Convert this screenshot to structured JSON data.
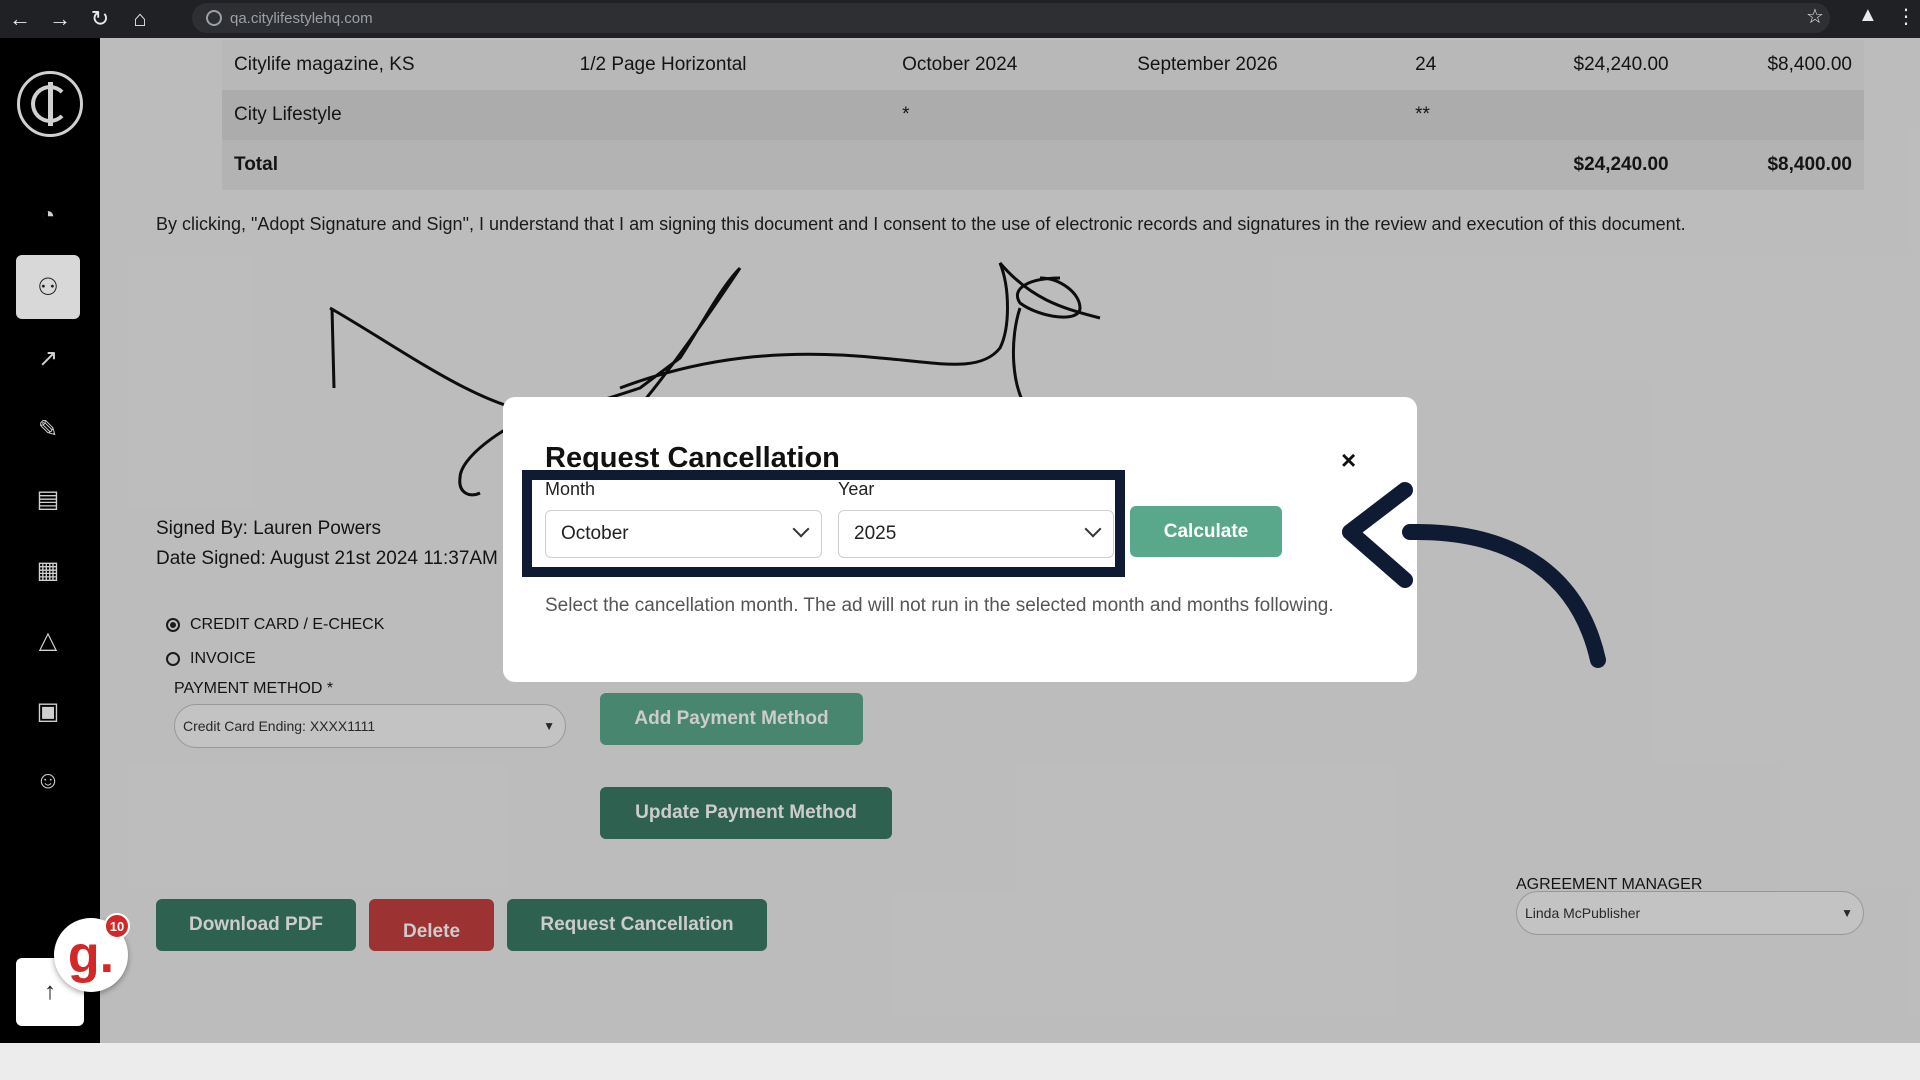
{
  "browser": {
    "url": "qa.citylifestylehq.com"
  },
  "orders": {
    "rows": [
      {
        "publication": "Citylife magazine, KS",
        "size": "1/2 Page Horizontal",
        "start": "October 2024",
        "end": "September 2026",
        "count": "24",
        "total": "$24,240.00",
        "amount": "$8,400.00"
      },
      {
        "publication": "City Lifestyle",
        "size": "",
        "start": "*",
        "end": "",
        "count": "**",
        "total": "",
        "amount": ""
      }
    ],
    "total": {
      "label": "Total",
      "total": "$24,240.00",
      "amount": "$8,400.00"
    }
  },
  "consent_text": "By clicking, \"Adopt Signature and Sign\", I understand that I am signing this document and I consent to the use of electronic records and signatures in the review and execution of this document.",
  "signed_by": "Signed By: Lauren Powers",
  "date_signed": "Date Signed: August 21st 2024 11:37AM",
  "payment": {
    "options": [
      "CREDIT CARD / E-CHECK",
      "INVOICE"
    ],
    "method_label": "PAYMENT METHOD *",
    "method_value": "Credit Card Ending: XXXX1111",
    "add_button": "Add Payment Method",
    "update_button": "Update Payment Method"
  },
  "actions": {
    "download": "Download PDF",
    "delete": "Delete",
    "request_cancellation": "Request Cancellation"
  },
  "agreement_manager": {
    "label": "AGREEMENT MANAGER",
    "value": "Linda McPublisher"
  },
  "modal": {
    "title": "Request Cancellation",
    "close": "×",
    "month_label": "Month",
    "month_value": "October",
    "year_label": "Year",
    "year_value": "2025",
    "calculate": "Calculate",
    "hint": "Select the cancellation month. The ad will not run in the selected month and months following."
  },
  "widgets": {
    "g_badge": "g.",
    "g_count": "10"
  },
  "colors": {
    "accent_green": "#5aa88b",
    "dark_green": "#3b7a66",
    "danger_red": "#c33f3f",
    "highlight_navy": "#0f1b33"
  }
}
